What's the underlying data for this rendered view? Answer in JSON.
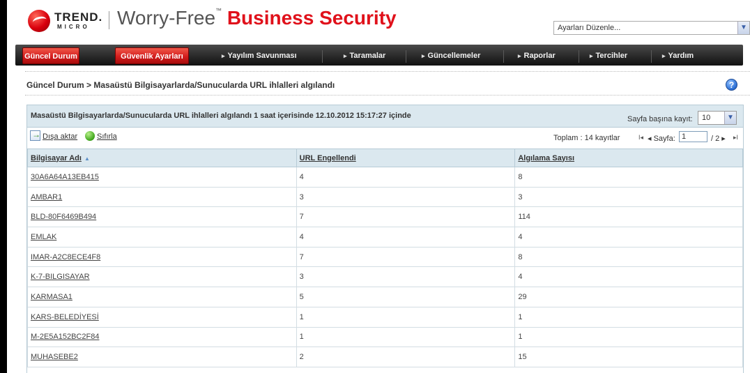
{
  "header": {
    "logo_trend": "TREND.",
    "logo_micro": "MICRO",
    "product_part1": "Worry-Free",
    "product_tm": "™",
    "product_part2": "Business Security",
    "settings_dropdown": "Ayarları Düzenle..."
  },
  "nav": {
    "tabs": [
      {
        "label": "Güncel Durum"
      },
      {
        "label": "Güvenlik Ayarları"
      },
      {
        "label": "Yayılım Savunması"
      },
      {
        "label": "Taramalar"
      },
      {
        "label": "Güncellemeler"
      },
      {
        "label": "Raporlar"
      },
      {
        "label": "Tercihler"
      },
      {
        "label": "Yardım"
      }
    ]
  },
  "breadcrumb": "Güncel Durum > Masaüstü Bilgisayarlarda/Sunucularda URL ihlalleri algılandı",
  "help_icon": "?",
  "panel": {
    "title": "Masaüstü Bilgisayarlarda/Sunucularda URL ihlalleri algılandı 1 saat içerisinde 12.10.2012 15:17:27 içinde",
    "per_page_label": "Sayfa başına kayıt:",
    "per_page_value": "10",
    "export_label": "Dışa aktar",
    "reset_label": "Sıfırla",
    "total_label": "Toplam : 14 kayıtlar",
    "page_label": "◂ Sayfa:",
    "page_value": "1",
    "page_of": "/ 2 ▸",
    "first_icon": "I◂",
    "last_icon": "▸I"
  },
  "table": {
    "columns": [
      "Bilgisayar Adı",
      "URL Engellendi",
      "Algılama Sayısı"
    ],
    "sort_icon": "▲",
    "rows": [
      [
        "30A6A64A13EB415",
        "4",
        "8"
      ],
      [
        "AMBAR1",
        "3",
        "3"
      ],
      [
        "BLD-80F6469B494",
        "7",
        "114"
      ],
      [
        "EMLAK",
        "4",
        "4"
      ],
      [
        "IMAR-A2C8ECE4F8",
        "7",
        "8"
      ],
      [
        "K-7-BILGISAYAR",
        "3",
        "4"
      ],
      [
        "KARMASA1",
        "5",
        "29"
      ],
      [
        "KARS-BELEDİYESİ",
        "1",
        "1"
      ],
      [
        "M-2E5A152BC2F84",
        "1",
        "1"
      ],
      [
        "MUHASEBE2",
        "2",
        "15"
      ]
    ]
  },
  "colors": {
    "accent_red": "#e0111b",
    "nav_dark": "#2a2a2a",
    "panel_header": "#dbe8ef"
  }
}
